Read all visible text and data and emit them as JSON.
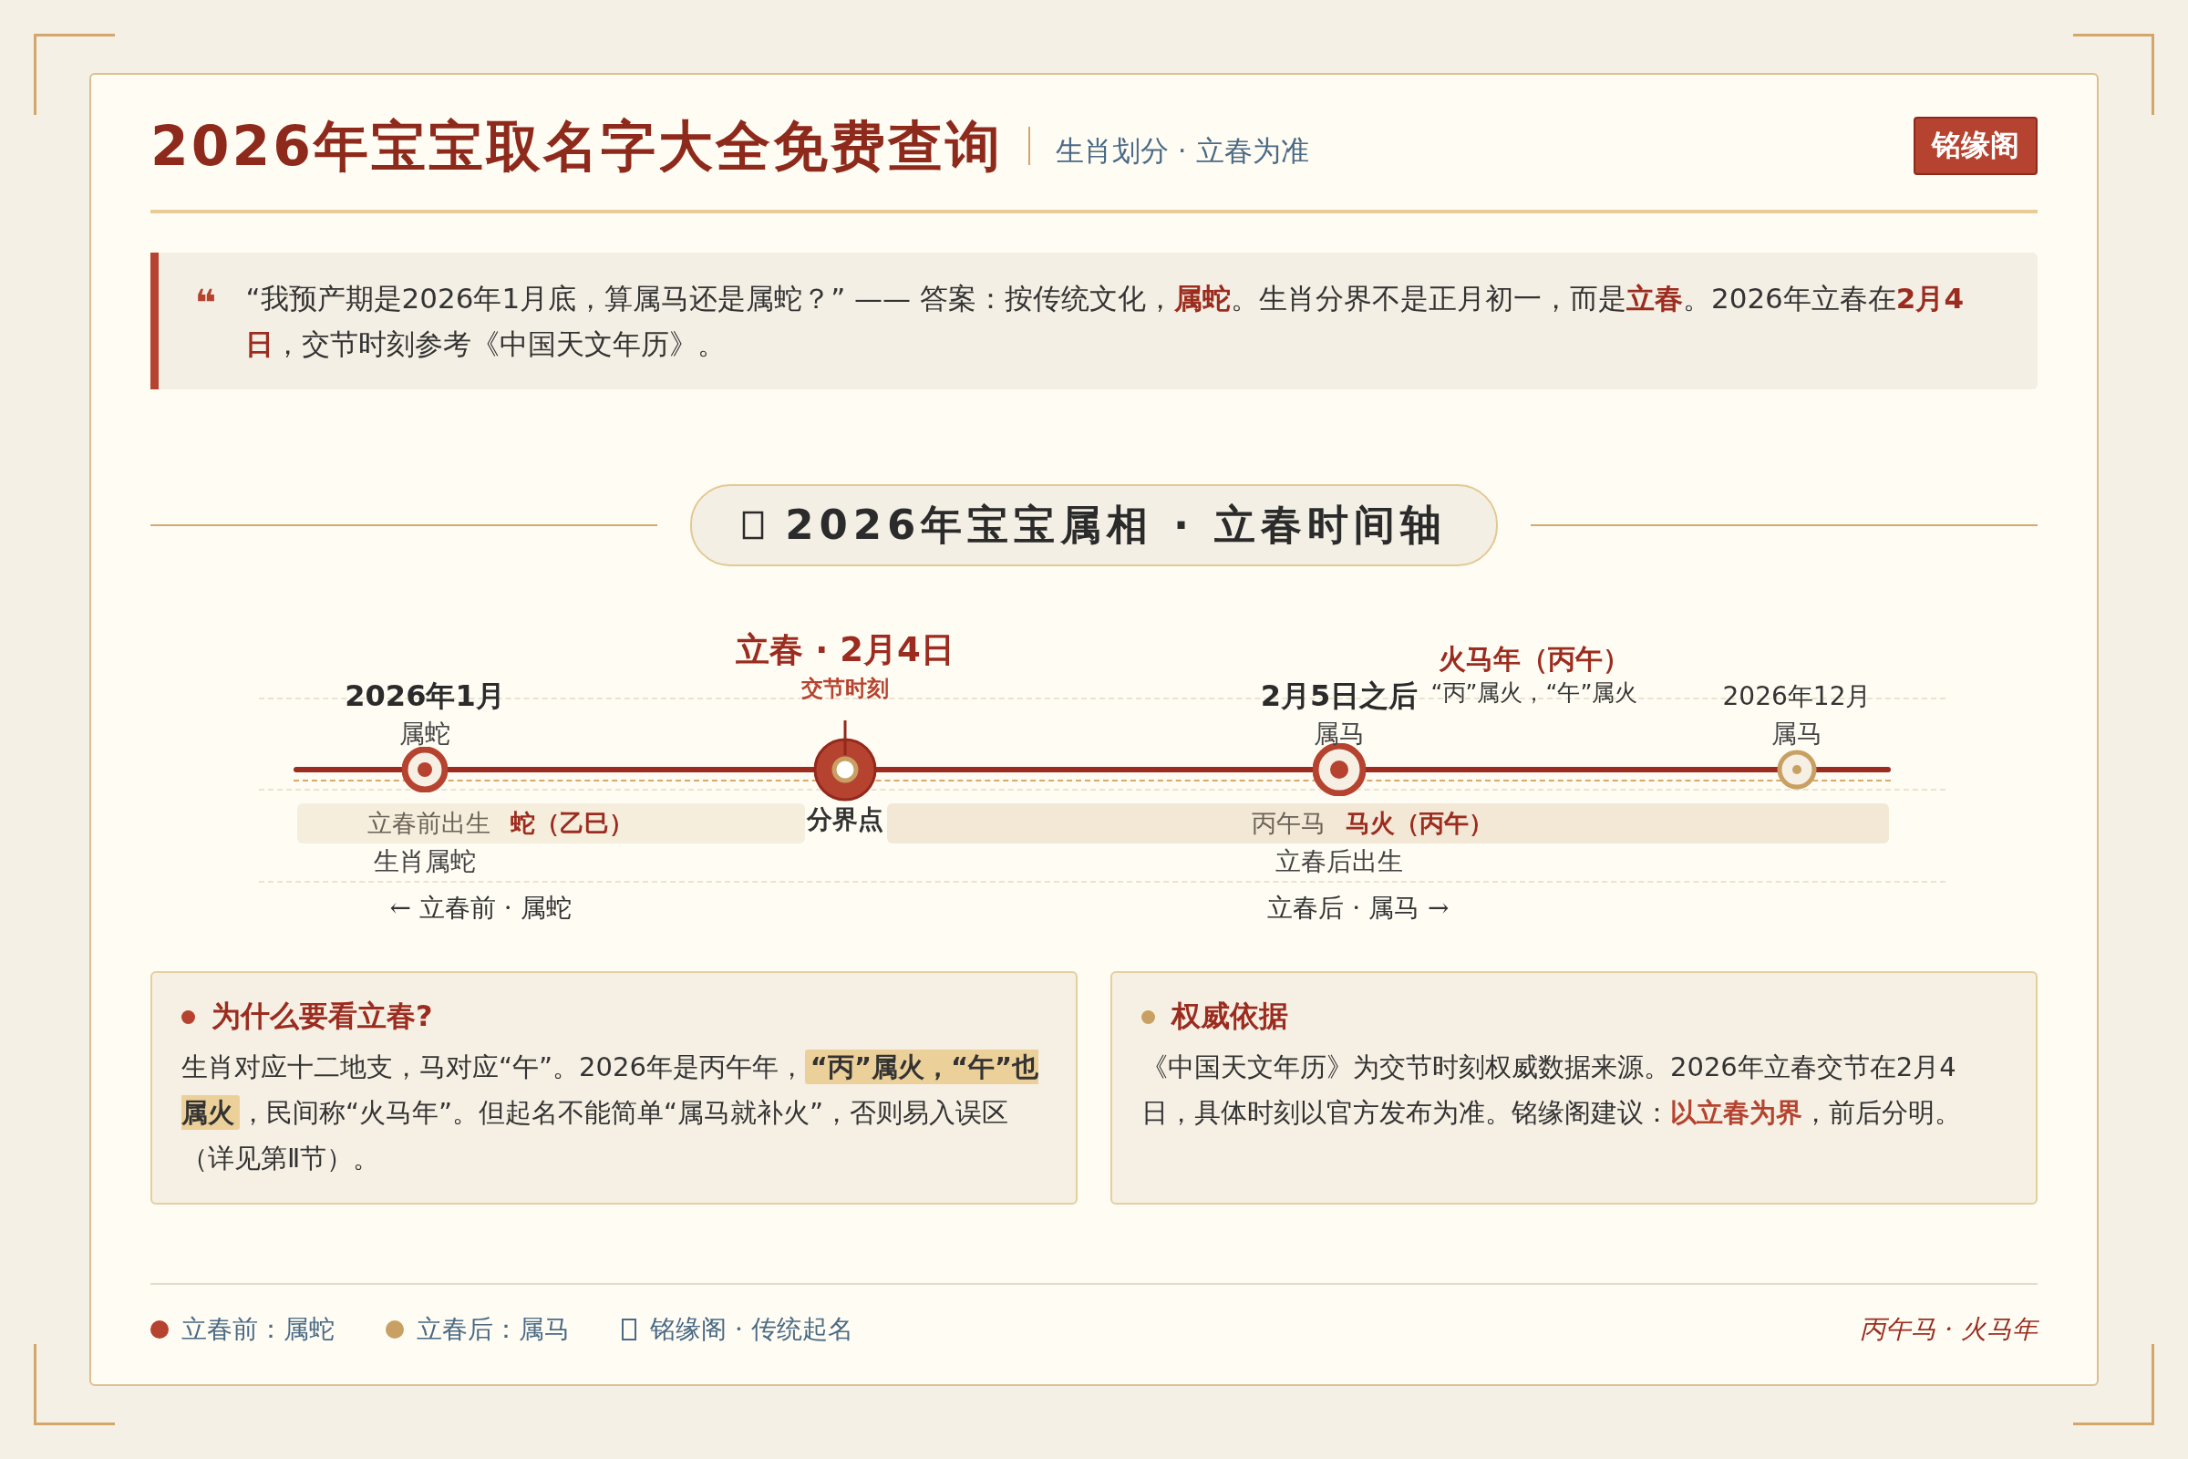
{
  "header": {
    "title": "2026年宝宝取名字大全免费查询",
    "subtitle": "生肖划分 · 立春为准",
    "badge": "铭缘阁"
  },
  "quote": {
    "mark": "❝",
    "text": "“我预产期是2026年1月底，算属马还是属蛇？” —— 答案：按传统文化，**属蛇**。生肖分界不是正月初一，而是**立春**。2026年立春在**2月4日**，交节时刻参考《中国天文年历》。"
  },
  "section_title": {
    "text": "2026年宝宝属相 · 立春时间轴"
  },
  "timeline": {
    "nodes": [
      {
        "kind": "start",
        "date": "2026年1月",
        "zodiac": "属蛇"
      },
      {
        "kind": "boundary",
        "date": "立春 · 2月4日",
        "zodiac": "交节时刻",
        "label": "分界点"
      },
      {
        "kind": "after",
        "date": "2月5日之后",
        "zodiac": "属马"
      },
      {
        "kind": "end",
        "date": "2026年12月",
        "zodiac": "属马"
      }
    ],
    "note": {
      "title": "火马年（丙午）",
      "text": "“丙”属火，“午”属火"
    },
    "bands": [
      {
        "kind": "before",
        "label": "立春前出生",
        "tag": "蛇（乙巳）",
        "caption": "生肖属蛇",
        "arrow": "← 立春前 · 属蛇"
      },
      {
        "kind": "after",
        "label": "丙午马",
        "tag": "马火（丙午）",
        "caption": "立春后出生",
        "arrow": "立春后 · 属马 →"
      }
    ]
  },
  "cards": [
    {
      "kind": "reason",
      "color": "#b5432f",
      "title": "为什么要看立春?",
      "text": "生肖对应十二地支，马对应“午”。2026年是丙午年，**“丙”属火，“午”也属火**，民间称“火马年”。但起名不能简单“属马就补火”，否则易入误区（详见第Ⅱ节）。"
    },
    {
      "kind": "source",
      "color": "#c9a063",
      "title": "权威依据",
      "text": "《中国天文年历》为交节时刻权威数据来源。2026年立春交节在2月4日，具体时刻以官方发布为准。铭缘阁建议：**以立春为界**，前后分明。"
    }
  ],
  "footer": {
    "legend": [
      {
        "kind": "dot",
        "color": "#b5432f",
        "text": "立春前：属蛇"
      },
      {
        "kind": "dot",
        "color": "#c9a063",
        "text": "立春后：属马"
      },
      {
        "kind": "box",
        "text": "铭缘阁 · 传统起名"
      }
    ],
    "tagline": "丙午马 · 火马年"
  }
}
